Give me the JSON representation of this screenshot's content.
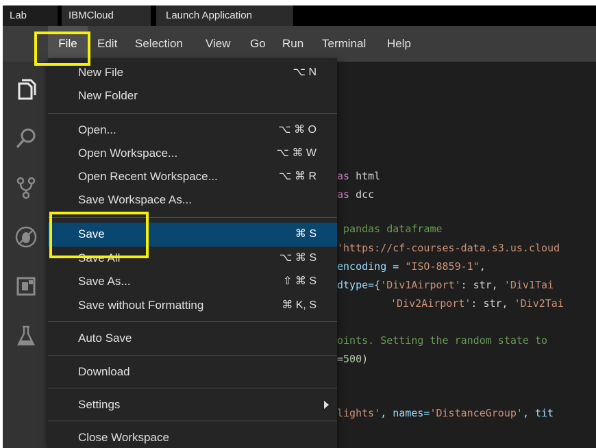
{
  "tabs": [
    "Lab",
    "IBMCloud",
    "Launch Application"
  ],
  "menubar": [
    "File",
    "Edit",
    "Selection",
    "View",
    "Go",
    "Run",
    "Terminal",
    "Help"
  ],
  "activity_icons": [
    "explorer-icon",
    "search-icon",
    "source-control-icon",
    "debug-icon",
    "extensions-icon",
    "lab-flask-icon"
  ],
  "file_menu": {
    "items": [
      {
        "label": "New File",
        "shortcut": "⌥ N"
      },
      {
        "label": "New Folder",
        "shortcut": ""
      },
      {
        "label": "Open...",
        "shortcut": "⌥ ⌘ O"
      },
      {
        "label": "Open Workspace...",
        "shortcut": "⌥ ⌘ W"
      },
      {
        "label": "Open Recent Workspace...",
        "shortcut": "⌥ ⌘ R"
      },
      {
        "label": "Save Workspace As...",
        "shortcut": ""
      },
      {
        "label": "Save",
        "shortcut": "⌘ S"
      },
      {
        "label": "Save All",
        "shortcut": "⌥ ⌘ S"
      },
      {
        "label": "Save As...",
        "shortcut": "⇧ ⌘ S"
      },
      {
        "label": "Save without Formatting",
        "shortcut": "⌘ K, S"
      },
      {
        "label": "Auto Save",
        "shortcut": ""
      },
      {
        "label": "Download",
        "shortcut": ""
      },
      {
        "label": "Settings",
        "shortcut": ""
      },
      {
        "label": "Close Workspace",
        "shortcut": ""
      }
    ]
  },
  "code": {
    "l1_kw": "as",
    "l1_rest": " html",
    "l2_kw": "as",
    "l2_rest": " dcc",
    "l3": " pandas dataframe",
    "l4": "'https://cf-courses-data.s3.us.cloud",
    "l5_a": "encoding = ",
    "l5_b": "\"ISO-8859-1\"",
    "l5_c": ",",
    "l6_a": "dtype={",
    "l6_b": "'Div1Airport'",
    "l6_c": ": str, ",
    "l6_d": "'Div1Tai",
    "l7_b": "'Div2Airport'",
    "l7_c": ": str, ",
    "l7_d": "'Div2Tai",
    "l8": "oints. Setting the random state to ",
    "l9_a": "=",
    "l9_b": "500",
    "l9_c": ")",
    "l10_a": "lights'",
    "l10_b": ", names=",
    "l10_c": "'DistanceGroup'",
    "l10_d": ", tit"
  },
  "colors": {
    "highlight": "#f6f00c",
    "selection": "#094771"
  }
}
